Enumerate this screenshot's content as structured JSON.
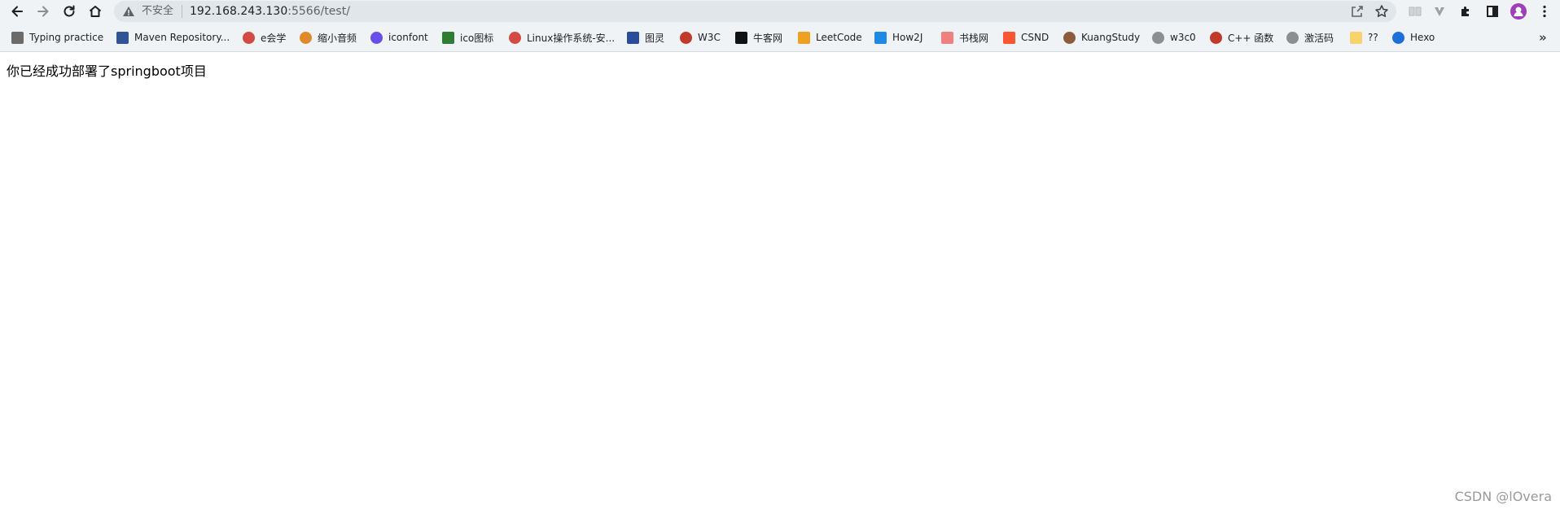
{
  "toolbar": {
    "back_icon": "arrow-left-icon",
    "forward_icon": "arrow-right-icon",
    "reload_icon": "reload-icon",
    "home_icon": "home-icon"
  },
  "omnibox": {
    "security_label": "不安全",
    "url_host": "192.168.243.130",
    "url_rest": ":5566/test/"
  },
  "bookmarks": [
    {
      "label": "Typing practice",
      "icon": "typing-icon",
      "color": "#6b6b6b"
    },
    {
      "label": "Maven Repository...",
      "icon": "maven-icon",
      "color": "#2f5597"
    },
    {
      "label": "e会学",
      "icon": "e-icon",
      "color": "#d24a43"
    },
    {
      "label": "缩小音频",
      "icon": "audio-icon",
      "color": "#e08a2c"
    },
    {
      "label": "iconfont",
      "icon": "iconfont-icon",
      "color": "#6a4ee8"
    },
    {
      "label": "ico图标",
      "icon": "ico-icon",
      "color": "#2e7d32"
    },
    {
      "label": "Linux操作系统-安...",
      "icon": "linux-icon",
      "color": "#d24a43"
    },
    {
      "label": "图灵",
      "icon": "turing-icon",
      "color": "#2a4d9b"
    },
    {
      "label": "W3C",
      "icon": "w3c-icon",
      "color": "#c0392b"
    },
    {
      "label": "牛客网",
      "icon": "nowcoder-icon",
      "color": "#111111"
    },
    {
      "label": "LeetCode",
      "icon": "leetcode-icon",
      "color": "#f0a020"
    },
    {
      "label": "How2J",
      "icon": "how2j-icon",
      "color": "#1e88e5"
    },
    {
      "label": "书栈网",
      "icon": "bookstack-icon",
      "color": "#f08080"
    },
    {
      "label": "CSND",
      "icon": "csdn-icon",
      "color": "#fc5531"
    },
    {
      "label": "KuangStudy",
      "icon": "kuangstudy-icon",
      "color": "#8d5a3b"
    },
    {
      "label": "w3c0",
      "icon": "globe-icon",
      "color": "#8a8f94"
    },
    {
      "label": "C++ 函数",
      "icon": "cpp-icon",
      "color": "#c0392b"
    },
    {
      "label": "激活码",
      "icon": "globe-icon",
      "color": "#8a8f94"
    },
    {
      "label": "??",
      "icon": "folder-icon",
      "color": "#f6d36b"
    },
    {
      "label": "Hexo",
      "icon": "hexo-icon",
      "color": "#1e6fd9"
    }
  ],
  "bookmarks_more": "»",
  "page": {
    "message": "你已经成功部署了springboot项目"
  },
  "watermark": "CSDN @lOvera"
}
